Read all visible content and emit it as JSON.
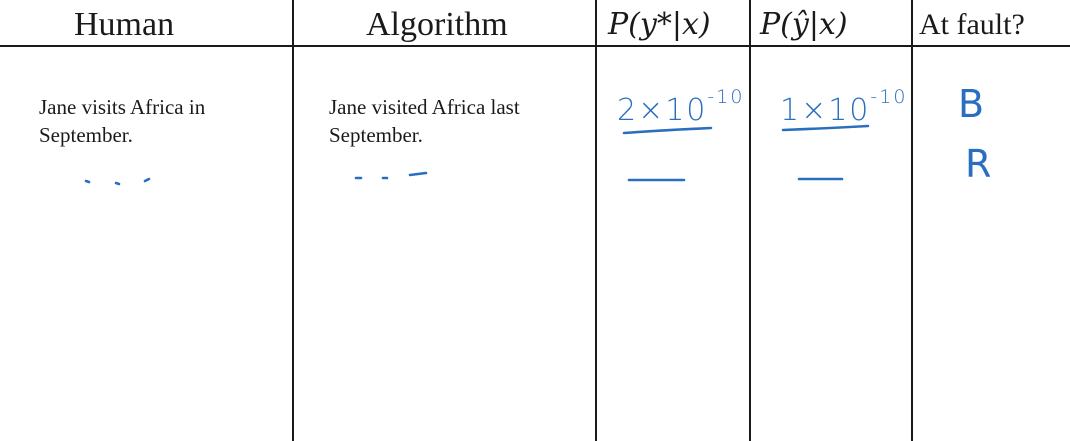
{
  "table": {
    "headers": {
      "human": "Human",
      "algorithm": "Algorithm",
      "p_ystar": "P(y*|x)",
      "p_yhat": "P(ŷ|x)",
      "at_fault": "At fault?"
    },
    "rows": [
      {
        "human": "Jane visits Africa in September.",
        "algorithm": "Jane visited Africa last September.",
        "p_ystar": {
          "mantissa": "2×10",
          "exponent": "-10"
        },
        "p_yhat": {
          "mantissa": "1×10",
          "exponent": "-10"
        },
        "at_fault": "B"
      },
      {
        "human": "",
        "algorithm": "",
        "p_ystar": "",
        "p_yhat": "",
        "at_fault": "R"
      }
    ]
  },
  "colors": {
    "ink": "#2a6fbf",
    "rule": "#1a1a1a"
  }
}
